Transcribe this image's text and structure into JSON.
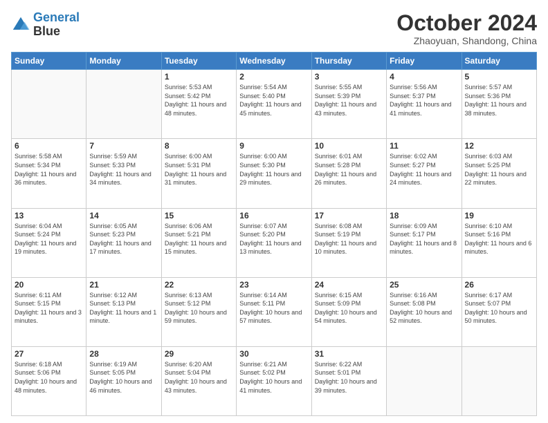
{
  "header": {
    "logo_line1": "General",
    "logo_line2": "Blue",
    "month": "October 2024",
    "location": "Zhaoyuan, Shandong, China"
  },
  "weekdays": [
    "Sunday",
    "Monday",
    "Tuesday",
    "Wednesday",
    "Thursday",
    "Friday",
    "Saturday"
  ],
  "weeks": [
    [
      {
        "day": "",
        "info": ""
      },
      {
        "day": "",
        "info": ""
      },
      {
        "day": "1",
        "info": "Sunrise: 5:53 AM\nSunset: 5:42 PM\nDaylight: 11 hours and 48 minutes."
      },
      {
        "day": "2",
        "info": "Sunrise: 5:54 AM\nSunset: 5:40 PM\nDaylight: 11 hours and 45 minutes."
      },
      {
        "day": "3",
        "info": "Sunrise: 5:55 AM\nSunset: 5:39 PM\nDaylight: 11 hours and 43 minutes."
      },
      {
        "day": "4",
        "info": "Sunrise: 5:56 AM\nSunset: 5:37 PM\nDaylight: 11 hours and 41 minutes."
      },
      {
        "day": "5",
        "info": "Sunrise: 5:57 AM\nSunset: 5:36 PM\nDaylight: 11 hours and 38 minutes."
      }
    ],
    [
      {
        "day": "6",
        "info": "Sunrise: 5:58 AM\nSunset: 5:34 PM\nDaylight: 11 hours and 36 minutes."
      },
      {
        "day": "7",
        "info": "Sunrise: 5:59 AM\nSunset: 5:33 PM\nDaylight: 11 hours and 34 minutes."
      },
      {
        "day": "8",
        "info": "Sunrise: 6:00 AM\nSunset: 5:31 PM\nDaylight: 11 hours and 31 minutes."
      },
      {
        "day": "9",
        "info": "Sunrise: 6:00 AM\nSunset: 5:30 PM\nDaylight: 11 hours and 29 minutes."
      },
      {
        "day": "10",
        "info": "Sunrise: 6:01 AM\nSunset: 5:28 PM\nDaylight: 11 hours and 26 minutes."
      },
      {
        "day": "11",
        "info": "Sunrise: 6:02 AM\nSunset: 5:27 PM\nDaylight: 11 hours and 24 minutes."
      },
      {
        "day": "12",
        "info": "Sunrise: 6:03 AM\nSunset: 5:25 PM\nDaylight: 11 hours and 22 minutes."
      }
    ],
    [
      {
        "day": "13",
        "info": "Sunrise: 6:04 AM\nSunset: 5:24 PM\nDaylight: 11 hours and 19 minutes."
      },
      {
        "day": "14",
        "info": "Sunrise: 6:05 AM\nSunset: 5:23 PM\nDaylight: 11 hours and 17 minutes."
      },
      {
        "day": "15",
        "info": "Sunrise: 6:06 AM\nSunset: 5:21 PM\nDaylight: 11 hours and 15 minutes."
      },
      {
        "day": "16",
        "info": "Sunrise: 6:07 AM\nSunset: 5:20 PM\nDaylight: 11 hours and 13 minutes."
      },
      {
        "day": "17",
        "info": "Sunrise: 6:08 AM\nSunset: 5:19 PM\nDaylight: 11 hours and 10 minutes."
      },
      {
        "day": "18",
        "info": "Sunrise: 6:09 AM\nSunset: 5:17 PM\nDaylight: 11 hours and 8 minutes."
      },
      {
        "day": "19",
        "info": "Sunrise: 6:10 AM\nSunset: 5:16 PM\nDaylight: 11 hours and 6 minutes."
      }
    ],
    [
      {
        "day": "20",
        "info": "Sunrise: 6:11 AM\nSunset: 5:15 PM\nDaylight: 11 hours and 3 minutes."
      },
      {
        "day": "21",
        "info": "Sunrise: 6:12 AM\nSunset: 5:13 PM\nDaylight: 11 hours and 1 minute."
      },
      {
        "day": "22",
        "info": "Sunrise: 6:13 AM\nSunset: 5:12 PM\nDaylight: 10 hours and 59 minutes."
      },
      {
        "day": "23",
        "info": "Sunrise: 6:14 AM\nSunset: 5:11 PM\nDaylight: 10 hours and 57 minutes."
      },
      {
        "day": "24",
        "info": "Sunrise: 6:15 AM\nSunset: 5:09 PM\nDaylight: 10 hours and 54 minutes."
      },
      {
        "day": "25",
        "info": "Sunrise: 6:16 AM\nSunset: 5:08 PM\nDaylight: 10 hours and 52 minutes."
      },
      {
        "day": "26",
        "info": "Sunrise: 6:17 AM\nSunset: 5:07 PM\nDaylight: 10 hours and 50 minutes."
      }
    ],
    [
      {
        "day": "27",
        "info": "Sunrise: 6:18 AM\nSunset: 5:06 PM\nDaylight: 10 hours and 48 minutes."
      },
      {
        "day": "28",
        "info": "Sunrise: 6:19 AM\nSunset: 5:05 PM\nDaylight: 10 hours and 46 minutes."
      },
      {
        "day": "29",
        "info": "Sunrise: 6:20 AM\nSunset: 5:04 PM\nDaylight: 10 hours and 43 minutes."
      },
      {
        "day": "30",
        "info": "Sunrise: 6:21 AM\nSunset: 5:02 PM\nDaylight: 10 hours and 41 minutes."
      },
      {
        "day": "31",
        "info": "Sunrise: 6:22 AM\nSunset: 5:01 PM\nDaylight: 10 hours and 39 minutes."
      },
      {
        "day": "",
        "info": ""
      },
      {
        "day": "",
        "info": ""
      }
    ]
  ]
}
